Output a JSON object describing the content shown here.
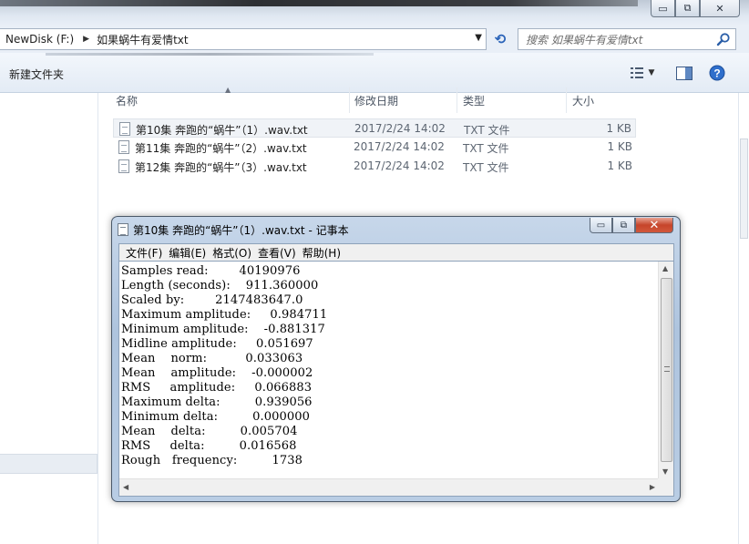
{
  "window": {
    "minimize_glyph": "▭",
    "maximize_glyph": "⧉",
    "close_glyph": "✕"
  },
  "address": {
    "drive": "NewDisk (F:)",
    "folder": "如果蜗牛有爱情txt",
    "separator": "▶",
    "dropdown": "▼",
    "refresh": "⟲"
  },
  "search": {
    "placeholder": "搜索 如果蜗牛有爱情txt"
  },
  "toolbar": {
    "new_folder": "新建文件夹",
    "view_caret": "▼"
  },
  "columns": {
    "name": "名称",
    "date": "修改日期",
    "type": "类型",
    "size": "大小"
  },
  "files": [
    {
      "name": "第10集 奔跑的“蜗牛”（1）.wav.txt",
      "date": "2017/2/24 14:02",
      "type": "TXT 文件",
      "size": "1 KB"
    },
    {
      "name": "第11集 奔跑的“蜗牛”（2）.wav.txt",
      "date": "2017/2/24 14:02",
      "type": "TXT 文件",
      "size": "1 KB"
    },
    {
      "name": "第12集 奔跑的“蜗牛”（3）.wav.txt",
      "date": "2017/2/24 14:02",
      "type": "TXT 文件",
      "size": "1 KB"
    }
  ],
  "notepad": {
    "title": "第10集 奔跑的“蜗牛”（1）.wav.txt - 记事本",
    "menu": [
      "文件(F)",
      "编辑(E)",
      "格式(O)",
      "查看(V)",
      "帮助(H)"
    ],
    "content": "Samples read:        40190976\nLength (seconds):    911.360000\nScaled by:        2147483647.0\nMaximum amplitude:     0.984711\nMinimum amplitude:    -0.881317\nMidline amplitude:     0.051697\nMean    norm:          0.033063\nMean    amplitude:    -0.000002\nRMS     amplitude:     0.066883\nMaximum delta:         0.939056\nMinimum delta:         0.000000\nMean    delta:         0.005704\nRMS     delta:         0.016568\nRough   frequency:         1738",
    "close_glyph": "✕"
  },
  "icons": [
    "search-icon",
    "refresh-icon",
    "views-icon",
    "preview-pane-icon",
    "help-icon",
    "text-file-icon"
  ]
}
